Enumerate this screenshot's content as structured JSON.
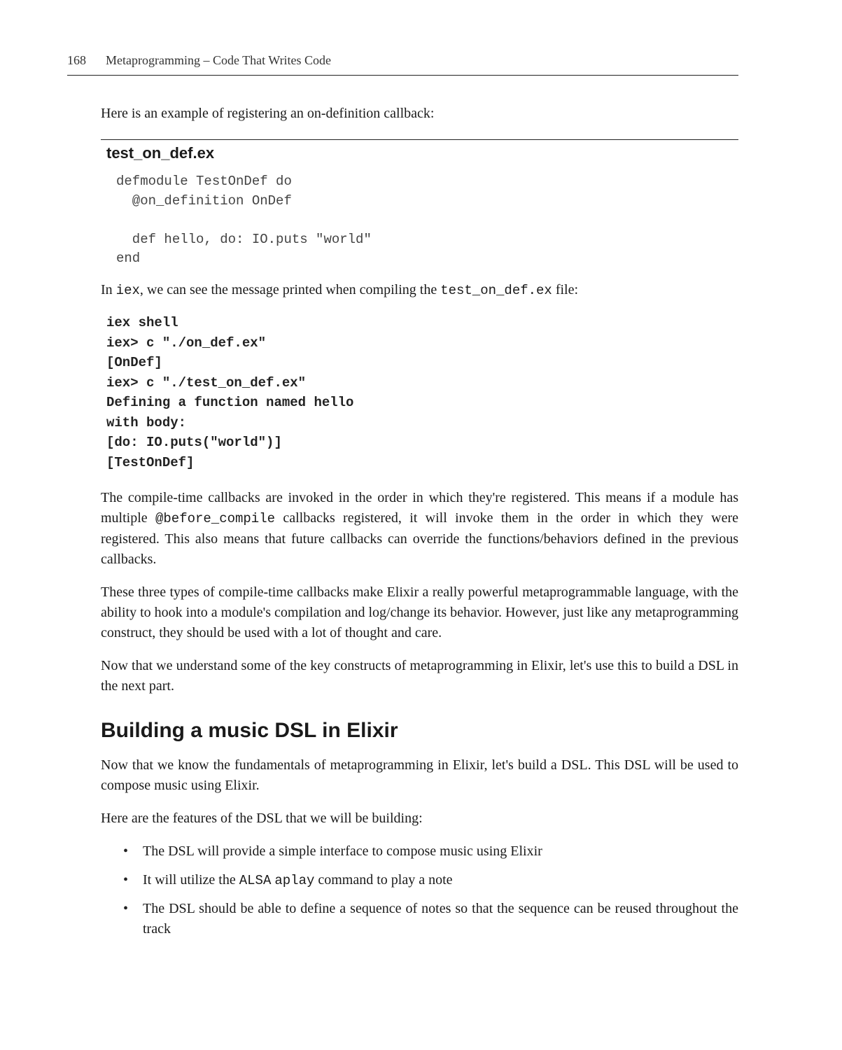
{
  "header": {
    "page_number": "168",
    "chapter_title": "Metaprogramming – Code That Writes Code"
  },
  "intro_line": "Here is an example of registering an on-definition callback:",
  "file_header": "test_on_def.ex",
  "code1": "defmodule TestOnDef do\n  @on_definition OnDef\n\n  def hello, do: IO.puts \"world\"\nend",
  "para2_pre": "In ",
  "para2_code1": "iex",
  "para2_mid": ", we can see the message printed when compiling the ",
  "para2_code2": "test_on_def.ex",
  "para2_post": " file:",
  "code2": "iex shell\niex> c \"./on_def.ex\"\n[OnDef]\niex> c \"./test_on_def.ex\"\nDefining a function named hello\nwith body:\n[do: IO.puts(\"world\")]\n[TestOnDef]",
  "para3_pre": "The compile-time callbacks are invoked in the order in which they're registered. This means if a module has multiple ",
  "para3_code": "@before_compile",
  "para3_post": " callbacks registered, it will invoke them in the order in which they were registered. This also means that future callbacks can override the functions/behaviors defined in the previous callbacks.",
  "para4": "These three types of compile-time callbacks make Elixir a really powerful metaprogrammable language, with the ability to hook into a module's compilation and log/change its behavior. However, just like any metaprogramming construct, they should be used with a lot of thought and care.",
  "para5": "Now that we understand some of the key constructs of metaprogramming in Elixir, let's use this to build a DSL in the next part.",
  "section_title": "Building a music DSL in Elixir",
  "para6": "Now that we know the fundamentals of metaprogramming in Elixir, let's build a DSL. This DSL will be used to compose music using Elixir.",
  "para7": "Here are the features of the DSL that we will be building:",
  "bullets": {
    "b1": "The DSL will provide a simple interface to compose music using Elixir",
    "b2_pre": "It will utilize the ",
    "b2_code1": "ALSA",
    "b2_mid": " ",
    "b2_code2": "aplay",
    "b2_post": " command to play a note",
    "b3": "The DSL should be able to define a sequence of notes so that the sequence can be reused throughout the track"
  }
}
